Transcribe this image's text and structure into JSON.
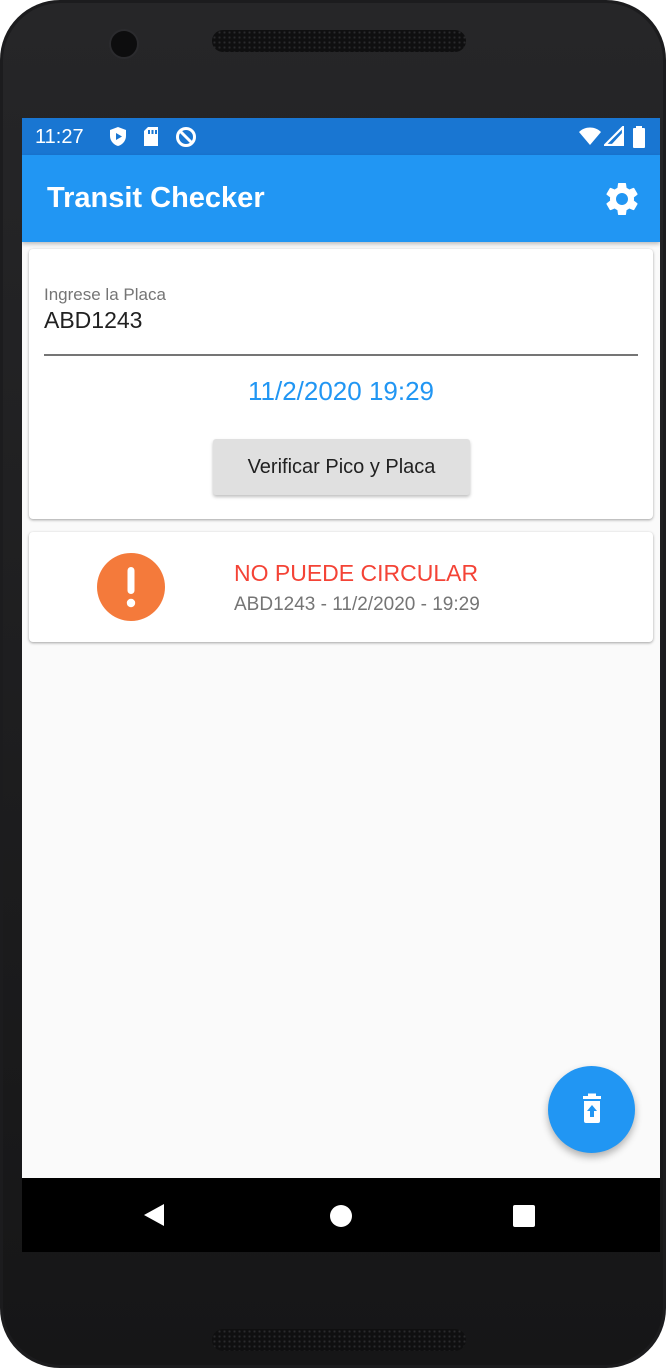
{
  "status_bar": {
    "time": "11:27"
  },
  "app_bar": {
    "title": "Transit Checker"
  },
  "plate_input": {
    "label": "Ingrese la Placa",
    "value": "ABD1243"
  },
  "datetime_display": "11/2/2020 19:29",
  "verify_button_label": "Verificar Pico y Placa",
  "result": {
    "status": "NO PUEDE CIRCULAR",
    "detail": "ABD1243 - 11/2/2020 - 19:29"
  },
  "colors": {
    "primary": "#2196f3",
    "status_bar": "#1976d2",
    "alert_icon": "#f47a3b",
    "error_text": "#f44336"
  },
  "icons": {
    "settings": "gear-icon",
    "alert": "exclamation-icon",
    "fab": "delete-restore-icon",
    "nav_back": "triangle-back-icon",
    "nav_home": "circle-home-icon",
    "nav_recents": "square-recents-icon"
  }
}
